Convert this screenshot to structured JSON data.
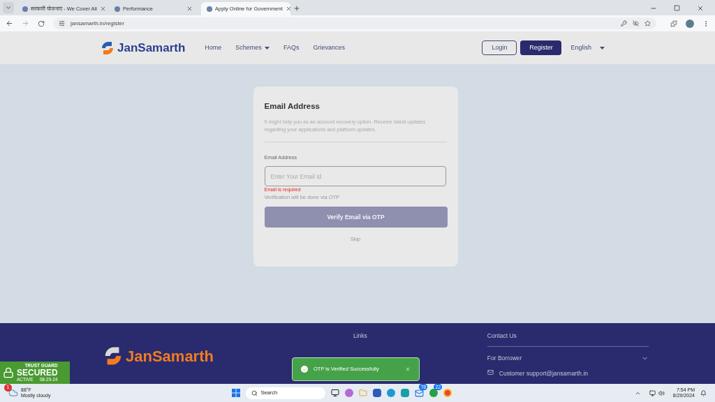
{
  "browser": {
    "tabs": [
      {
        "title": "सरकारी योजनाएं - We Cover All",
        "selected": false
      },
      {
        "title": "Performance",
        "selected": false
      },
      {
        "title": "Apply Online for Government",
        "selected": true
      }
    ],
    "url": "jansamarth.in/register"
  },
  "header": {
    "logo": "JanSamarth",
    "nav": [
      {
        "label": "Home",
        "kind": "link"
      },
      {
        "label": "Schemes",
        "kind": "dropdown"
      },
      {
        "label": "FAQs",
        "kind": "link"
      },
      {
        "label": "Grievances",
        "kind": "link"
      }
    ],
    "login": "Login",
    "register": "Register",
    "language": "English"
  },
  "card": {
    "title": "Email Address",
    "description": "It might help you as an account recovery option. Receive latest updates regarding your applications and platform updates.",
    "field_label": "Email Address",
    "placeholder": "Enter Your Email Id",
    "error": "Email is required",
    "hint": "Verification will be done via OTP",
    "verify_button": "Verify Email via OTP",
    "skip": "Skip"
  },
  "footer": {
    "logo": "JanSamarth",
    "links_heading": "Links",
    "contact_heading": "Contact Us",
    "for_borrower": "For Borrower",
    "contact_line": "Customer support@jansamarth.in"
  },
  "toast": {
    "message": "OTP is Verified Successfully"
  },
  "trust_badge": {
    "top": "TRUST GUARD",
    "main": "SECURED",
    "status": "ACTIVE",
    "date": "08-29-24"
  },
  "taskbar": {
    "weather_alert": "1",
    "temperature": "88°F",
    "condition": "Mostly cloudy",
    "search": "Search",
    "mail_count": "78",
    "chat_count": "22",
    "time": "7:54 PM",
    "date": "8/29/2024"
  }
}
